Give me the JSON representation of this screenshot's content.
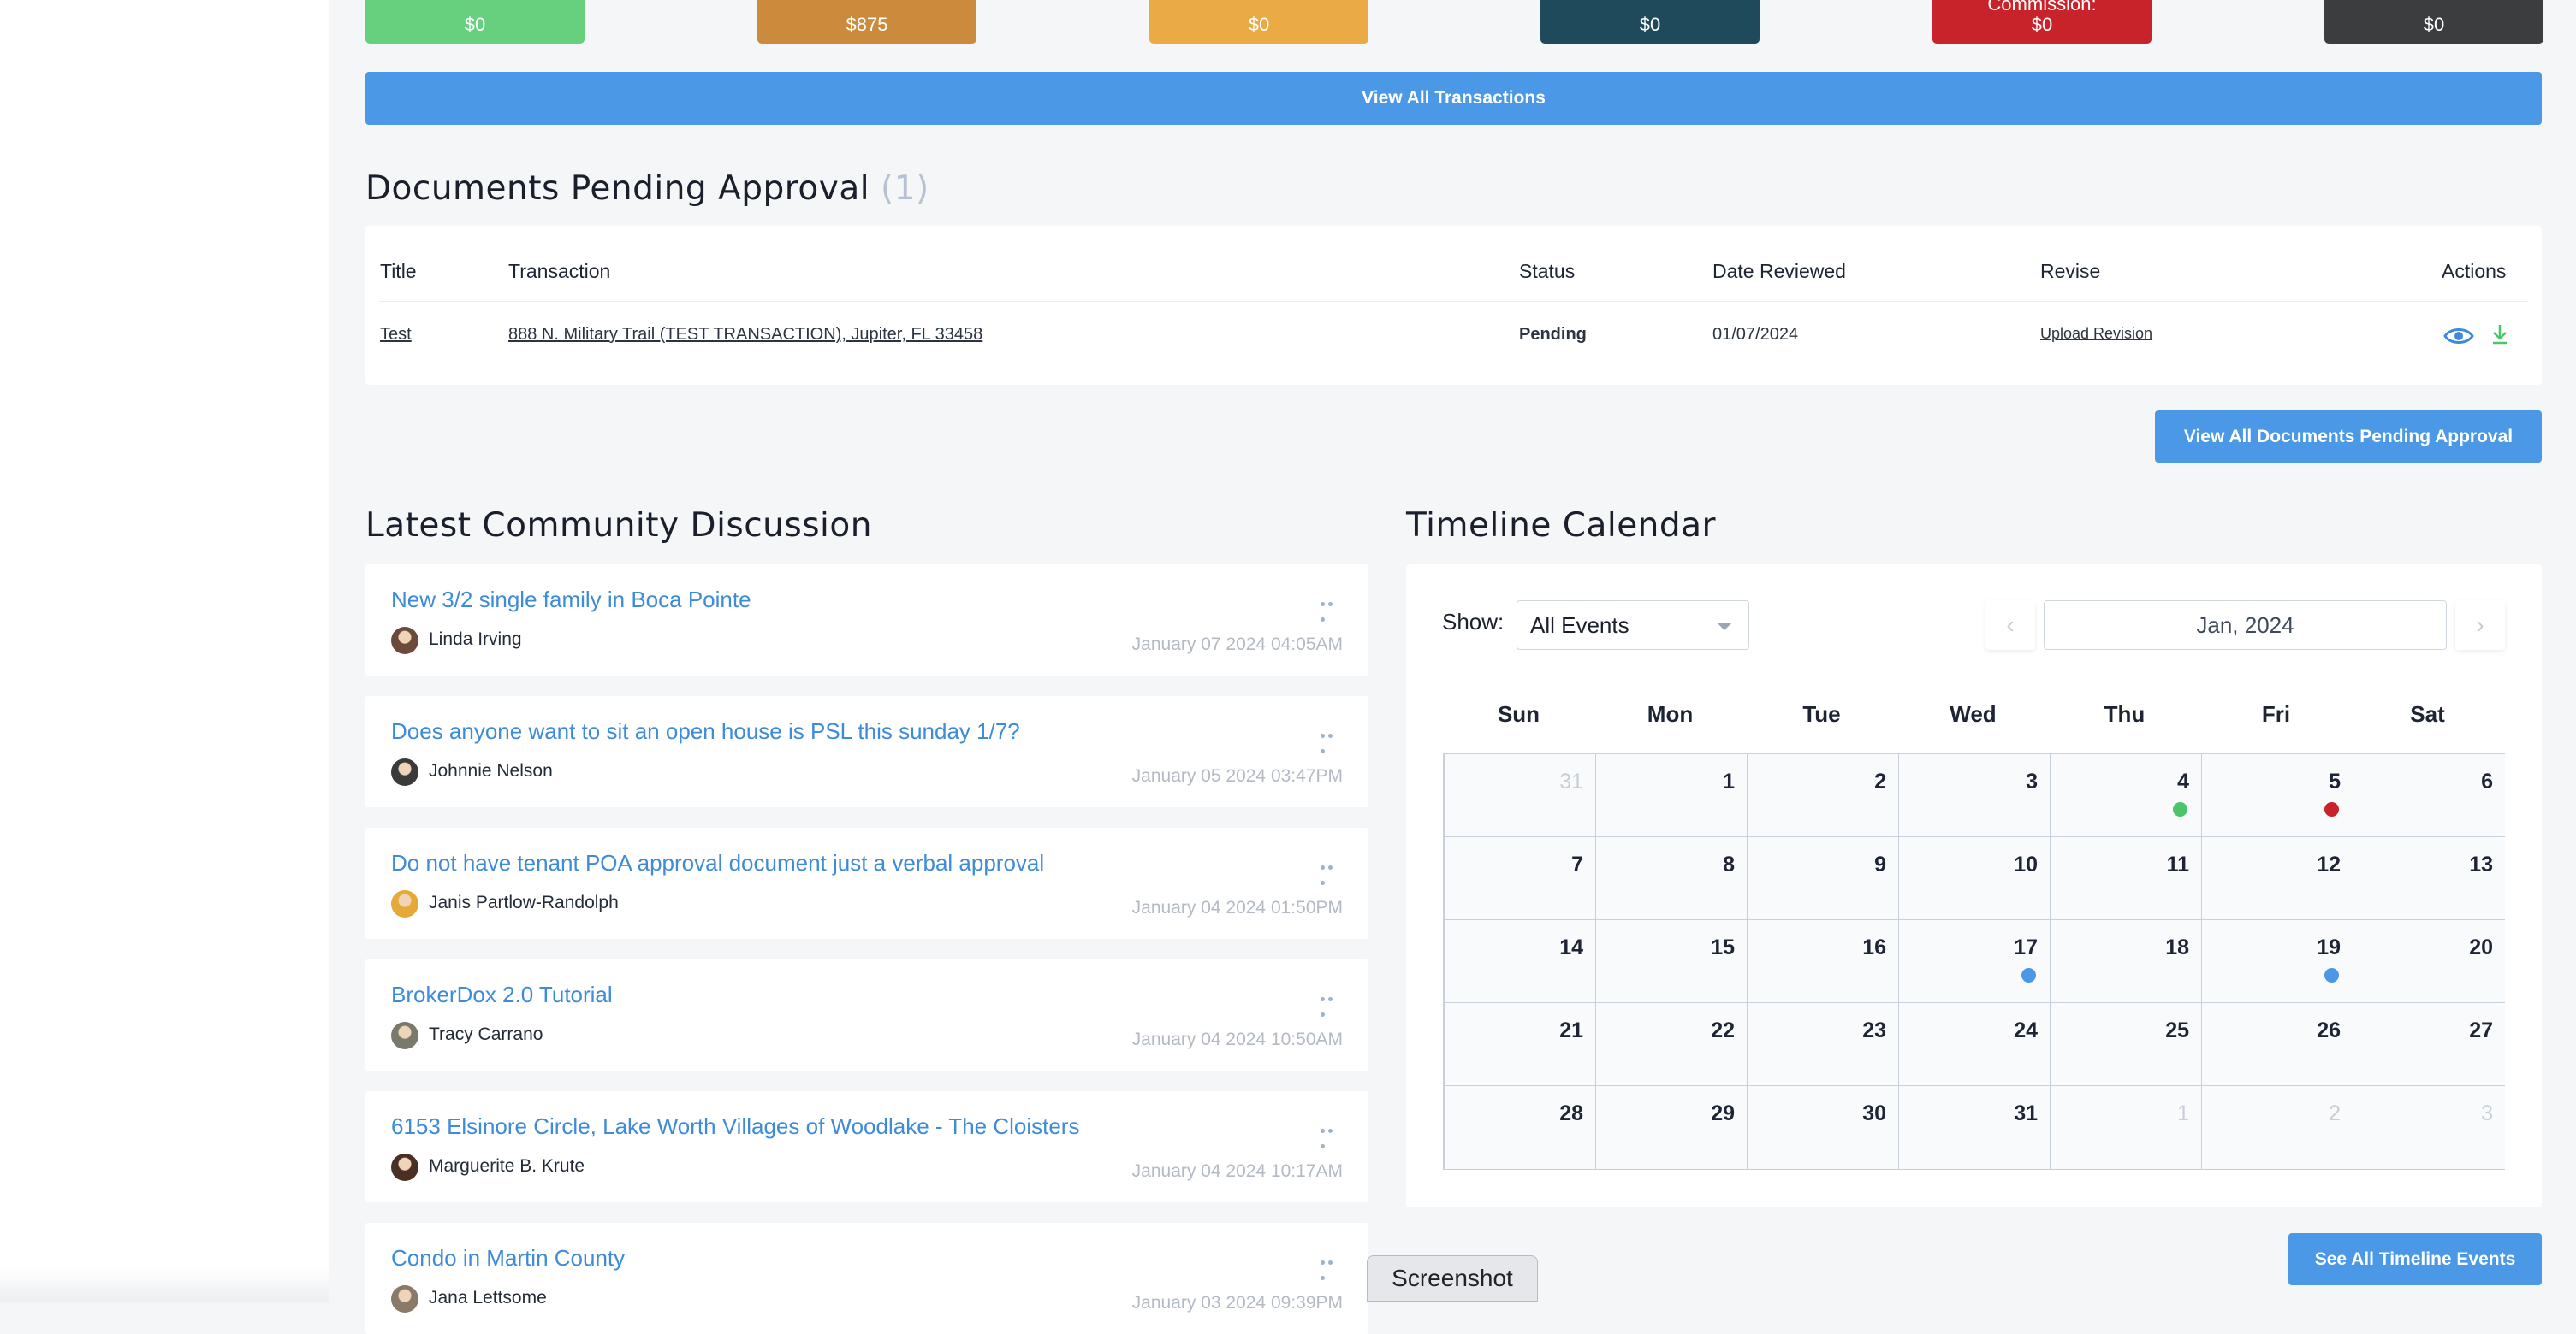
{
  "stats": [
    {
      "label": "",
      "value": "$0",
      "color": "#67d07e"
    },
    {
      "label": "",
      "value": "$875",
      "color": "#cc8b3c"
    },
    {
      "label": "",
      "value": "$0",
      "color": "#eaaa45"
    },
    {
      "label": "",
      "value": "$0",
      "color": "#1f4a5c"
    },
    {
      "label": "Commission:",
      "value": "$0",
      "color": "#c8232a"
    },
    {
      "label": "",
      "value": "$0",
      "color": "#3b3d3f"
    }
  ],
  "view_all_transactions": "View All Transactions",
  "documents": {
    "title": "Documents Pending Approval",
    "count": "(1)",
    "headers": [
      "Title",
      "Transaction",
      "Status",
      "Date Reviewed",
      "Revise",
      "Actions"
    ],
    "rows": [
      {
        "title": "Test",
        "transaction": "888 N. Military Trail (TEST TRANSACTION), Jupiter, FL 33458",
        "status": "Pending",
        "date": "01/07/2024",
        "revise": "Upload Revision"
      }
    ],
    "view_all": "View All Documents Pending Approval"
  },
  "discussion": {
    "title": "Latest Community Discussion",
    "posts": [
      {
        "title": "New 3/2 single family in Boca Pointe",
        "author": "Linda Irving",
        "date": "January 07 2024 04:05AM"
      },
      {
        "title": "Does anyone want to sit an open house is PSL this sunday 1/7?",
        "author": "Johnnie Nelson",
        "date": "January 05 2024 03:47PM"
      },
      {
        "title": "Do not have tenant POA approval document just a verbal approval",
        "author": "Janis Partlow-Randolph",
        "date": "January 04 2024 01:50PM"
      },
      {
        "title": "BrokerDox 2.0 Tutorial",
        "author": "Tracy Carrano",
        "date": "January 04 2024 10:50AM"
      },
      {
        "title": "6153 Elsinore Circle, Lake Worth Villages of Woodlake - The Cloisters",
        "author": "Marguerite B. Krute",
        "date": "January 04 2024 10:17AM"
      },
      {
        "title": "Condo in Martin County",
        "author": "Jana Lettsome",
        "date": "January 03 2024 09:39PM"
      }
    ]
  },
  "calendar": {
    "title": "Timeline Calendar",
    "show_label": "Show:",
    "filter": "All Events",
    "month": "Jan, 2024",
    "prev_icon": "‹",
    "next_icon": "›",
    "weekdays": [
      "Sun",
      "Mon",
      "Tue",
      "Wed",
      "Thu",
      "Fri",
      "Sat"
    ],
    "days": [
      {
        "n": "31",
        "muted": true
      },
      {
        "n": "1"
      },
      {
        "n": "2"
      },
      {
        "n": "3"
      },
      {
        "n": "4",
        "dot": "#4cc46c"
      },
      {
        "n": "5",
        "dot": "#c8232a"
      },
      {
        "n": "6"
      },
      {
        "n": "7"
      },
      {
        "n": "8"
      },
      {
        "n": "9"
      },
      {
        "n": "10"
      },
      {
        "n": "11"
      },
      {
        "n": "12"
      },
      {
        "n": "13"
      },
      {
        "n": "14"
      },
      {
        "n": "15"
      },
      {
        "n": "16"
      },
      {
        "n": "17",
        "dot": "#4a98e6"
      },
      {
        "n": "18"
      },
      {
        "n": "19",
        "dot": "#4a98e6"
      },
      {
        "n": "20"
      },
      {
        "n": "21"
      },
      {
        "n": "22"
      },
      {
        "n": "23"
      },
      {
        "n": "24"
      },
      {
        "n": "25"
      },
      {
        "n": "26"
      },
      {
        "n": "27"
      },
      {
        "n": "28"
      },
      {
        "n": "29"
      },
      {
        "n": "30"
      },
      {
        "n": "31"
      },
      {
        "n": "1",
        "muted": true
      },
      {
        "n": "2",
        "muted": true
      },
      {
        "n": "3",
        "muted": true
      }
    ],
    "see_all": "See All Timeline Events"
  },
  "screenshot_tag": "Screenshot"
}
